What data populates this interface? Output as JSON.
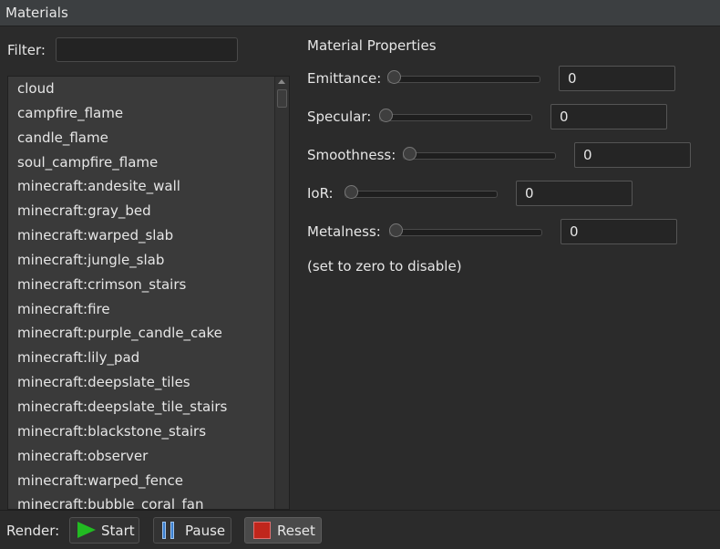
{
  "window": {
    "title": "Materials"
  },
  "filter": {
    "label": "Filter:",
    "value": ""
  },
  "materials": [
    "cloud",
    "campfire_flame",
    "candle_flame",
    "soul_campfire_flame",
    "minecraft:andesite_wall",
    "minecraft:gray_bed",
    "minecraft:warped_slab",
    "minecraft:jungle_slab",
    "minecraft:crimson_stairs",
    "minecraft:fire",
    "minecraft:purple_candle_cake",
    "minecraft:lily_pad",
    "minecraft:deepslate_tiles",
    "minecraft:deepslate_tile_stairs",
    "minecraft:blackstone_stairs",
    "minecraft:observer",
    "minecraft:warped_fence",
    "minecraft:bubble_coral_fan"
  ],
  "properties": {
    "title": "Material Properties",
    "emittance": {
      "label": "Emittance:",
      "value": "0",
      "level": 0
    },
    "specular": {
      "label": "Specular:",
      "value": "0",
      "level": 0
    },
    "smoothness": {
      "label": "Smoothness:",
      "value": "0",
      "level": 0
    },
    "ior": {
      "label": "IoR:",
      "value": "0",
      "level": 0
    },
    "metalness": {
      "label": "Metalness:",
      "value": "0",
      "level": 0
    },
    "hint": "(set to zero to disable)"
  },
  "render": {
    "label": "Render:",
    "start_label": "Start",
    "pause_label": "Pause",
    "reset_label": "Reset"
  },
  "icons": {
    "start": "play-icon",
    "pause": "pause-icon",
    "reset": "stop-icon"
  },
  "colors": {
    "play": "#22bb22",
    "pause": "#3a7fd0",
    "stop": "#c0261c"
  }
}
